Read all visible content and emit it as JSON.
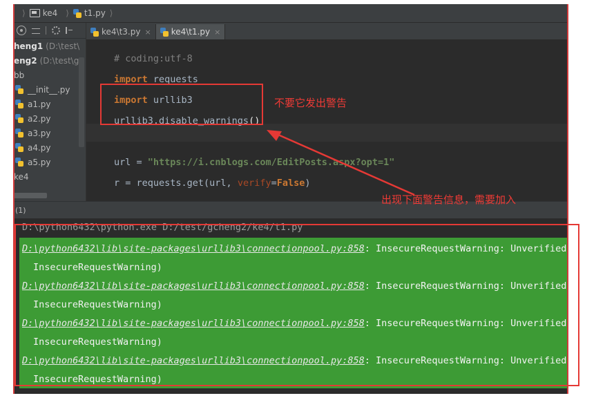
{
  "breadcrumb": {
    "folder": "ke4",
    "file": "t1.py"
  },
  "project": {
    "items": [
      {
        "label": "heng1",
        "path": "(D:\\test\\",
        "kind": "folder",
        "bold": true
      },
      {
        "label": "eng2",
        "path": "(D:\\test\\g",
        "kind": "folder",
        "bold": true
      },
      {
        "label": "bb",
        "path": "",
        "kind": "folder",
        "bold": false
      },
      {
        "label": "__init__.py",
        "kind": "file"
      },
      {
        "label": "a1.py",
        "kind": "file"
      },
      {
        "label": "a2.py",
        "kind": "file"
      },
      {
        "label": "a3.py",
        "kind": "file"
      },
      {
        "label": "a4.py",
        "kind": "file"
      },
      {
        "label": "a5.py",
        "kind": "file"
      },
      {
        "label": "ke4",
        "path": "",
        "kind": "folder",
        "bold": false
      }
    ]
  },
  "tabs": [
    {
      "label": "ke4\\t3.py",
      "close": "×",
      "active": false
    },
    {
      "label": "ke4\\t1.py",
      "close": "×",
      "active": true
    }
  ],
  "code": {
    "l1": "# coding:utf-8",
    "l2_kw": "import",
    "l2_mod": " requests",
    "l3_kw": "import",
    "l3_mod": " urllib3",
    "l4_call": "urllib3.disable_warnings",
    "l4_paren": "()",
    "l6_a": "url = ",
    "l6_str": "\"https://i.cnblogs.com/EditPosts.aspx?opt=1\"",
    "l7_a": "r = requests.get(url, ",
    "l7_kw": "verify",
    "l7_eq": "=",
    "l7_val": "False",
    "l7_end": ")"
  },
  "run": {
    "header": "(1)"
  },
  "console": {
    "cmd": "D:\\python6432\\python.exe D:/test/gcheng2/ke4/t1.py",
    "path": "D:\\python6432\\lib\\site-packages\\urllib3\\connectionpool.py:858",
    "msg": ": InsecureRequestWarning: Unverified H",
    "cont": "InsecureRequestWarning)"
  },
  "annotations": {
    "note1": "不要它发出警告",
    "note2": "出现下面警告信息，需要加入"
  },
  "colors": {
    "annotation": "#e53935",
    "console_highlight": "#3d9b35",
    "keyword": "#cc7832",
    "string": "#6a8759"
  }
}
